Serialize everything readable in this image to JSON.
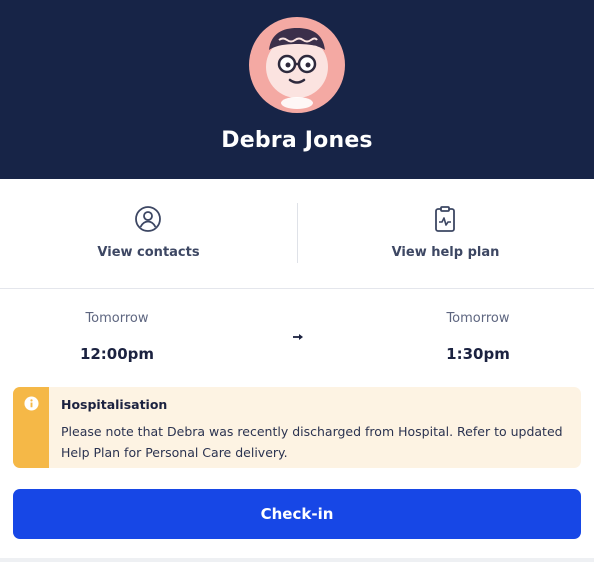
{
  "patient": {
    "name": "Debra Jones",
    "avatar_icon": "cartoon-face-avatar"
  },
  "actions": {
    "contacts": {
      "label": "View contacts",
      "icon": "person-circle-icon"
    },
    "help_plan": {
      "label": "View help plan",
      "icon": "clipboard-chart-icon"
    }
  },
  "schedule": {
    "start": {
      "day": "Tomorrow",
      "time": "12:00pm"
    },
    "end": {
      "day": "Tomorrow",
      "time": "1:30pm"
    },
    "separator_icon": "arrow-right-icon"
  },
  "alert": {
    "title": "Hospitalisation",
    "body": "Please note that Debra was recently discharged from Hospital. Refer to updated Help Plan for Personal Care delivery.",
    "icon": "info-icon",
    "accent_color": "#f5b847",
    "background_color": "#fdf3e3"
  },
  "checkin": {
    "label": "Check-in",
    "color": "#1747e6"
  },
  "colors": {
    "header": "#172447"
  }
}
